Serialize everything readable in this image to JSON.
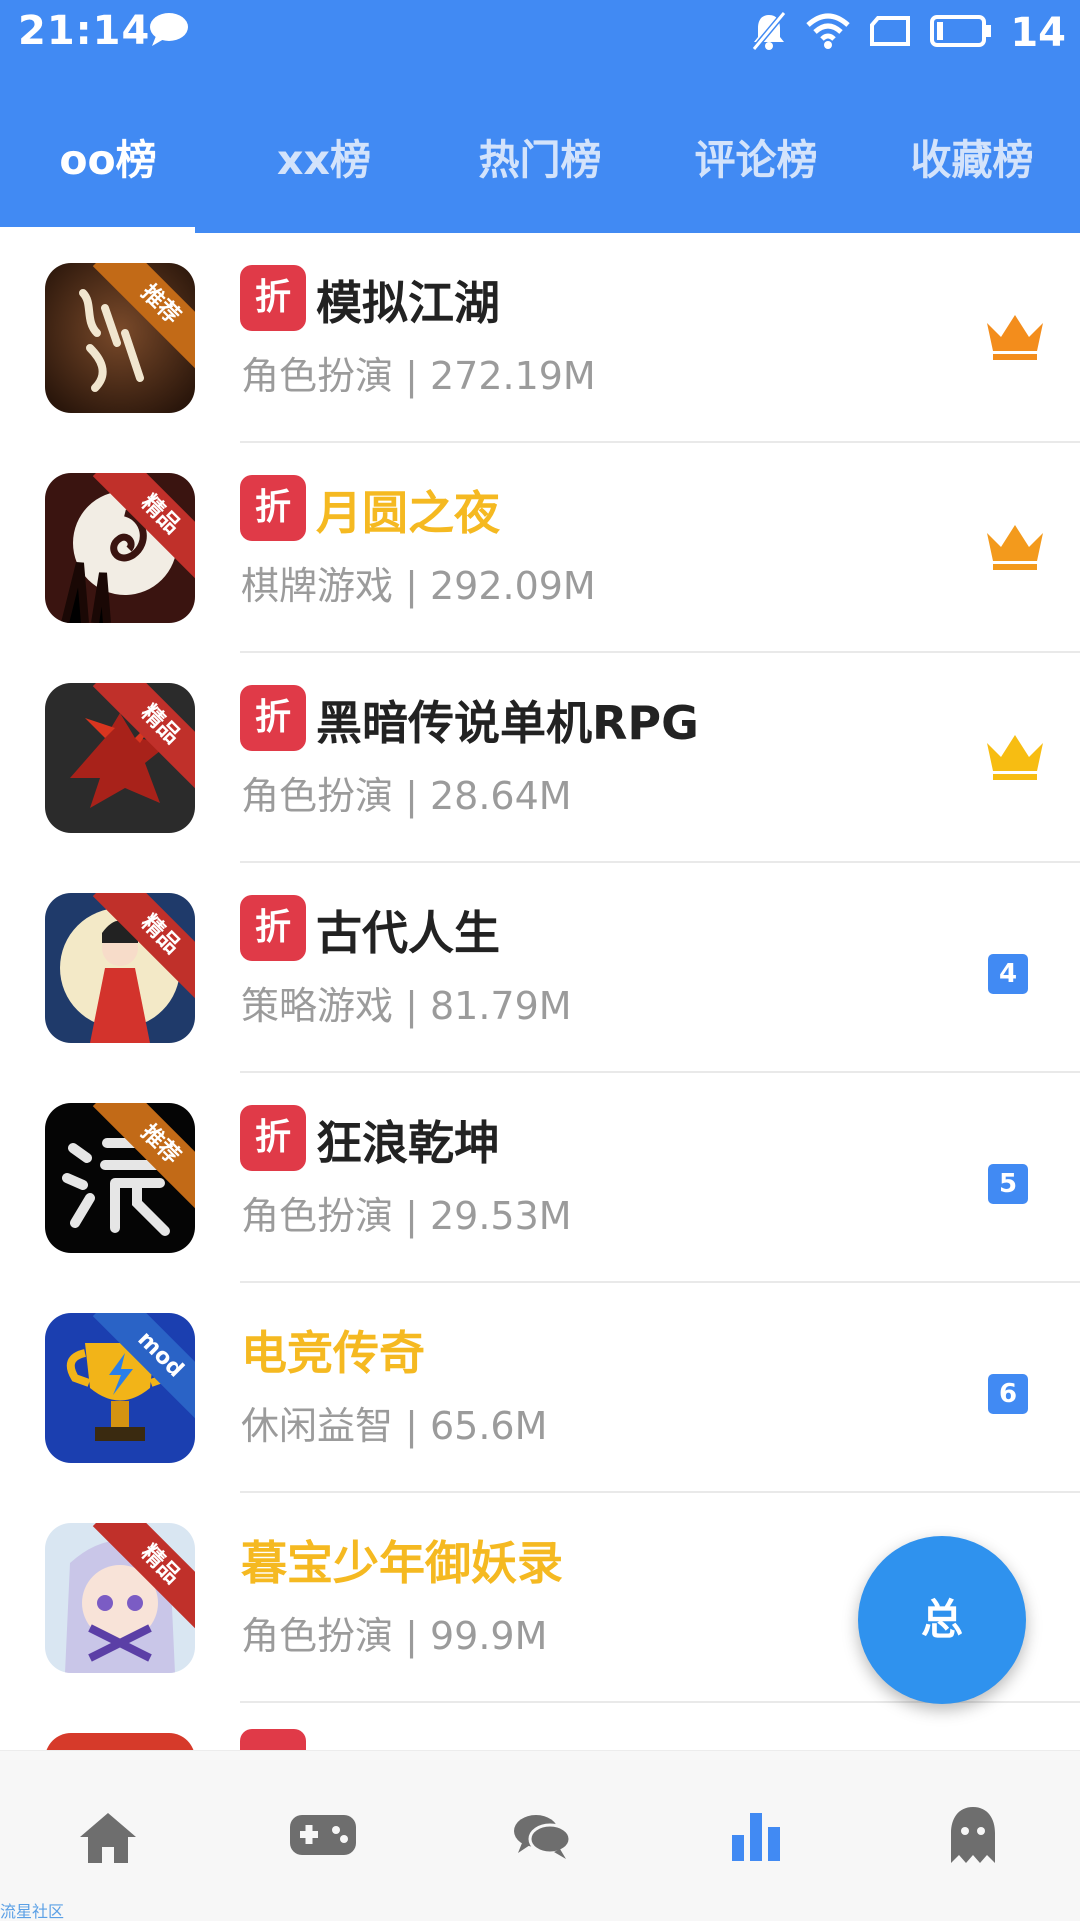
{
  "status_bar": {
    "time": "21:14",
    "battery_level": "14"
  },
  "tabs": [
    {
      "label": "oo榜",
      "active": true
    },
    {
      "label": "xx榜",
      "active": false
    },
    {
      "label": "热门榜",
      "active": false
    },
    {
      "label": "评论榜",
      "active": false
    },
    {
      "label": "收藏榜",
      "active": false
    }
  ],
  "list": [
    {
      "name": "模拟江湖",
      "category": "角色扮演 | 272.19M",
      "discount": "折",
      "badge": "推荐",
      "rank": "1",
      "rank_display": "crown",
      "crown_color": "#f38d1c",
      "title_color": "#222222"
    },
    {
      "name": "月圆之夜",
      "category": "棋牌游戏 | 292.09M",
      "discount": "折",
      "badge": "精品",
      "rank": "2",
      "rank_display": "crown",
      "crown_color": "#f39a1c",
      "title_color": "#f5b921"
    },
    {
      "name": "黑暗传说单机RPG",
      "category": "角色扮演 | 28.64M",
      "discount": "折",
      "badge": "精品",
      "rank": "3",
      "rank_display": "crown",
      "crown_color": "#f7bd12",
      "title_color": "#222222"
    },
    {
      "name": "古代人生",
      "category": "策略游戏 | 81.79M",
      "discount": "折",
      "badge": "精品",
      "rank": "4",
      "title_color": "#222222"
    },
    {
      "name": "狂浪乾坤",
      "category": "角色扮演 | 29.53M",
      "discount": "折",
      "badge": "推荐",
      "rank": "5",
      "title_color": "#222222"
    },
    {
      "name": "电竞传奇",
      "category": "休闲益智 | 65.6M",
      "badge": "mod",
      "rank": "6",
      "title_color": "#f5b921"
    },
    {
      "name": "暮宝少年御妖录",
      "category": "角色扮演 | 99.9M",
      "badge": "精品",
      "title_color": "#f5b921"
    }
  ],
  "fab": {
    "label": "总"
  },
  "bottom_nav": [
    "home-icon",
    "gamepad-icon",
    "chat-bubbles-icon",
    "bar-chart-icon",
    "ghost-icon"
  ],
  "watermark": "流星社区",
  "colors": {
    "primary": "#418af3",
    "discount": "#e03a48",
    "highlight_title": "#f5b921",
    "fab": "#2f92ee"
  }
}
